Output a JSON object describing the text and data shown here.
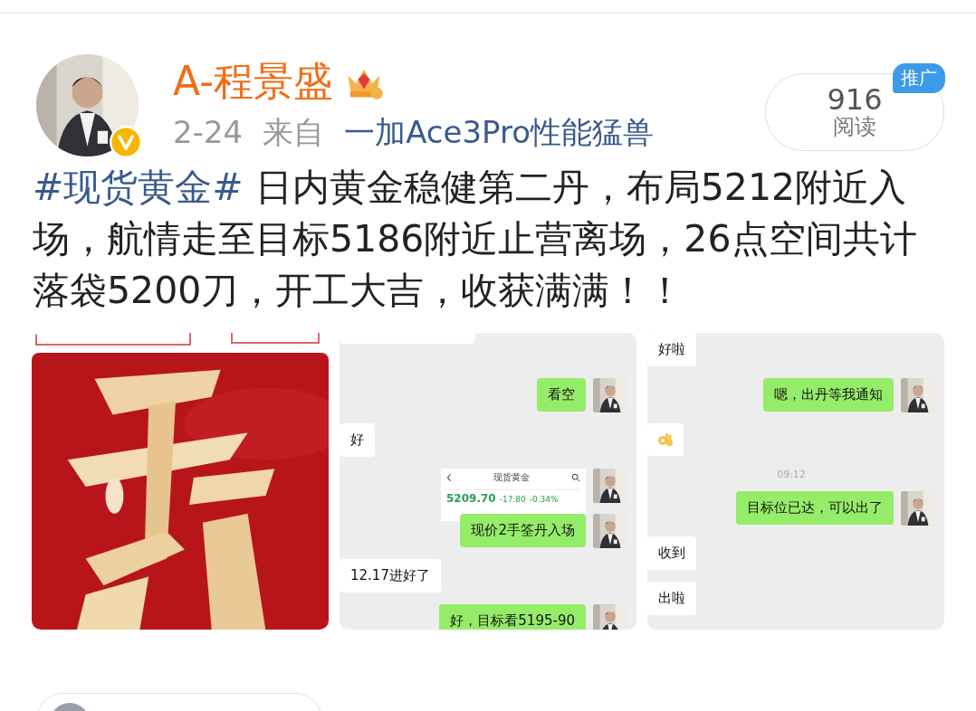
{
  "author": {
    "name": "A-程景盛",
    "verified": true
  },
  "meta": {
    "date": "2-24",
    "from_label": "来自",
    "device": "一加Ace3Pro性能猛兽"
  },
  "read_count": {
    "count": "916",
    "label": "阅读",
    "tag": "推广"
  },
  "post": {
    "hashtag": "#现货黄金#",
    "text": " 日内黄金稳健第二丹，布局5212附近入场，航情走至目标5186附近止营离场，26点空间共计落袋5200刀，开工大吉，收获满满！！"
  },
  "images": [
    {
      "kind": "picture"
    },
    {
      "kind": "chat",
      "messages": [
        {
          "kind": "cut",
          "outgoing": false
        },
        {
          "kind": "text",
          "outgoing": true,
          "text": "看空"
        },
        {
          "kind": "text",
          "outgoing": false,
          "text": "好"
        },
        {
          "kind": "stock",
          "outgoing": true,
          "title": "现货黄金",
          "price": "5209.70",
          "change": "-17.80",
          "percent": "-0.34%"
        },
        {
          "kind": "text",
          "outgoing": true,
          "text": "现价2手筌丹入场"
        },
        {
          "kind": "text",
          "outgoing": false,
          "text": "12.17进好了"
        },
        {
          "kind": "text",
          "outgoing": true,
          "text": "好，目标看5195-90"
        }
      ]
    },
    {
      "kind": "chat",
      "messages": [
        {
          "kind": "text",
          "outgoing": false,
          "text": "好啦"
        },
        {
          "kind": "text",
          "outgoing": true,
          "text": "嗯，出丹等我通知"
        },
        {
          "kind": "emoji",
          "outgoing": false
        },
        {
          "kind": "time",
          "text": "09:12"
        },
        {
          "kind": "text",
          "outgoing": true,
          "text": "目标位已达，可以出了"
        },
        {
          "kind": "text",
          "outgoing": false,
          "text": "收到"
        },
        {
          "kind": "text",
          "outgoing": false,
          "text": "出啦"
        }
      ]
    }
  ]
}
